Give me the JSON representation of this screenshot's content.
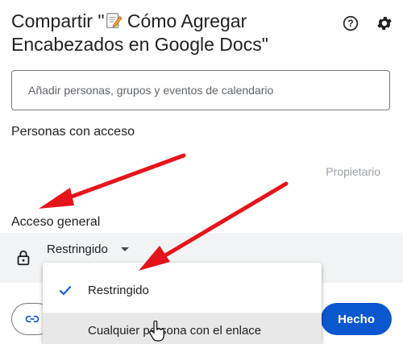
{
  "dialog": {
    "title_prefix": "Compartir \"",
    "title_doc": "Cómo Agregar Encabezados en Google Docs",
    "title_suffix": "\"",
    "help_icon": "help-circle-icon",
    "settings_icon": "gear-icon"
  },
  "add_people": {
    "placeholder": "Añadir personas, grupos y eventos de calendario"
  },
  "people_with_access": {
    "heading": "Personas con acceso",
    "owner_label": "Propietario"
  },
  "general_access": {
    "heading": "Acceso general",
    "lock_icon": "lock-icon",
    "selected": "Restringido"
  },
  "dropdown_menu": {
    "options": [
      {
        "label": "Restringido",
        "checked": true
      },
      {
        "label": "Cualquier persona con el enlace",
        "checked": false
      }
    ]
  },
  "footer": {
    "copy_link_icon": "link-icon",
    "done_label": "Hecho"
  },
  "colors": {
    "primary": "#0b57d0",
    "check": "#0b57d0",
    "annotation_arrow": "#e5141b"
  }
}
